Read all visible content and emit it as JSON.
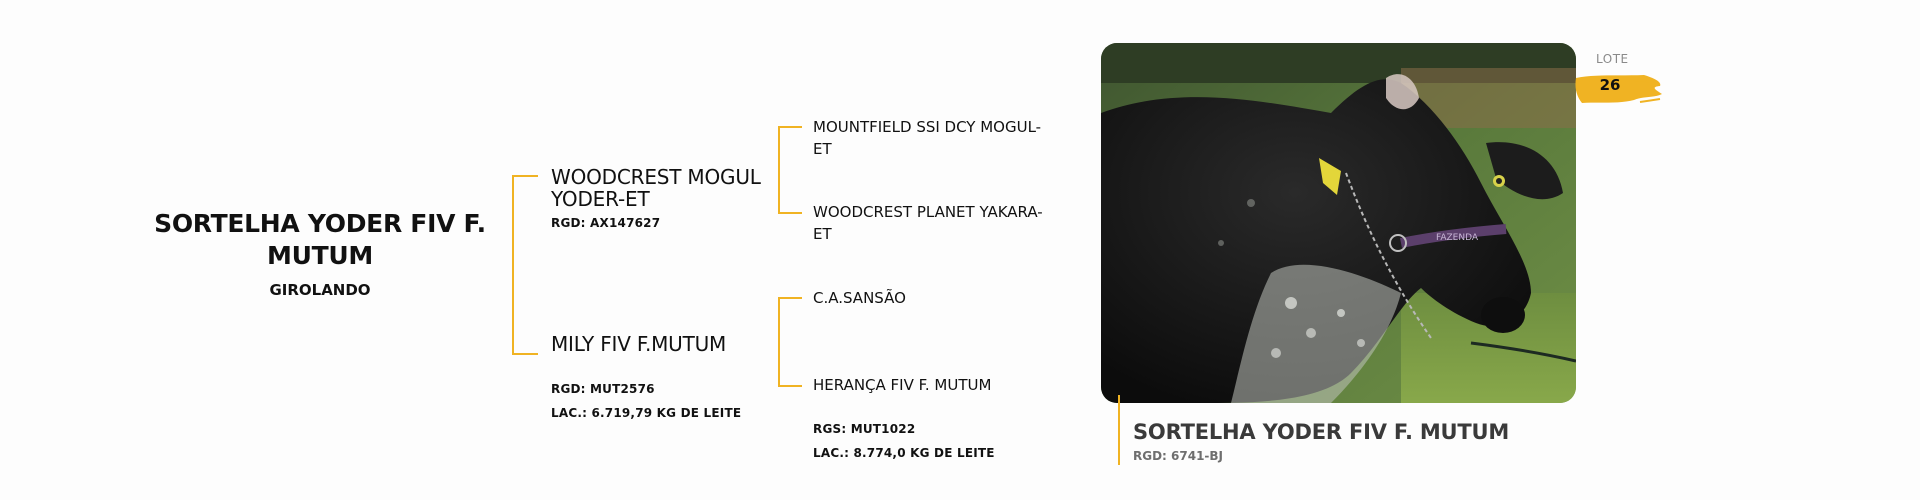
{
  "animal": {
    "name_line1": "SORTELHA YODER FIV F.",
    "name_line2": "MUTUM",
    "breed": "GIROLANDO"
  },
  "pedigree": {
    "sire": {
      "name_line1": "WOODCREST MOGUL",
      "name_line2": "YODER-ET",
      "rgd": "RGD: AX147627",
      "sire": {
        "line1": "MOUNTFIELD SSI DCY MOGUL-",
        "line2": "ET"
      },
      "dam": {
        "line1": "WOODCREST PLANET YAKARA-",
        "line2": "ET"
      }
    },
    "dam": {
      "name": "MILY FIV F.MUTUM",
      "rgd": "RGD: MUT2576",
      "lac": "LAC.: 6.719,79 KG DE LEITE",
      "sire": {
        "name": "C.A.SANSÃO"
      },
      "dam": {
        "name": "HERANÇA FIV F. MUTUM",
        "rgs": "RGS: MUT1022",
        "lac": "LAC.: 8.774,0 KG DE LEITE"
      }
    }
  },
  "photo": {
    "subject": "black and white speckled Girolando cow with halter and ear tag",
    "halter_text": "FAZENDA"
  },
  "lot": {
    "label": "LOTE",
    "number": "26"
  },
  "caption": {
    "name": "SORTELHA YODER FIV F. MUTUM",
    "rgd": "RGD: 6741-BJ"
  },
  "colors": {
    "accent": "#f0b323",
    "text": "#111111",
    "caption": "#3a3a3a",
    "muted": "#8a8a8a"
  }
}
